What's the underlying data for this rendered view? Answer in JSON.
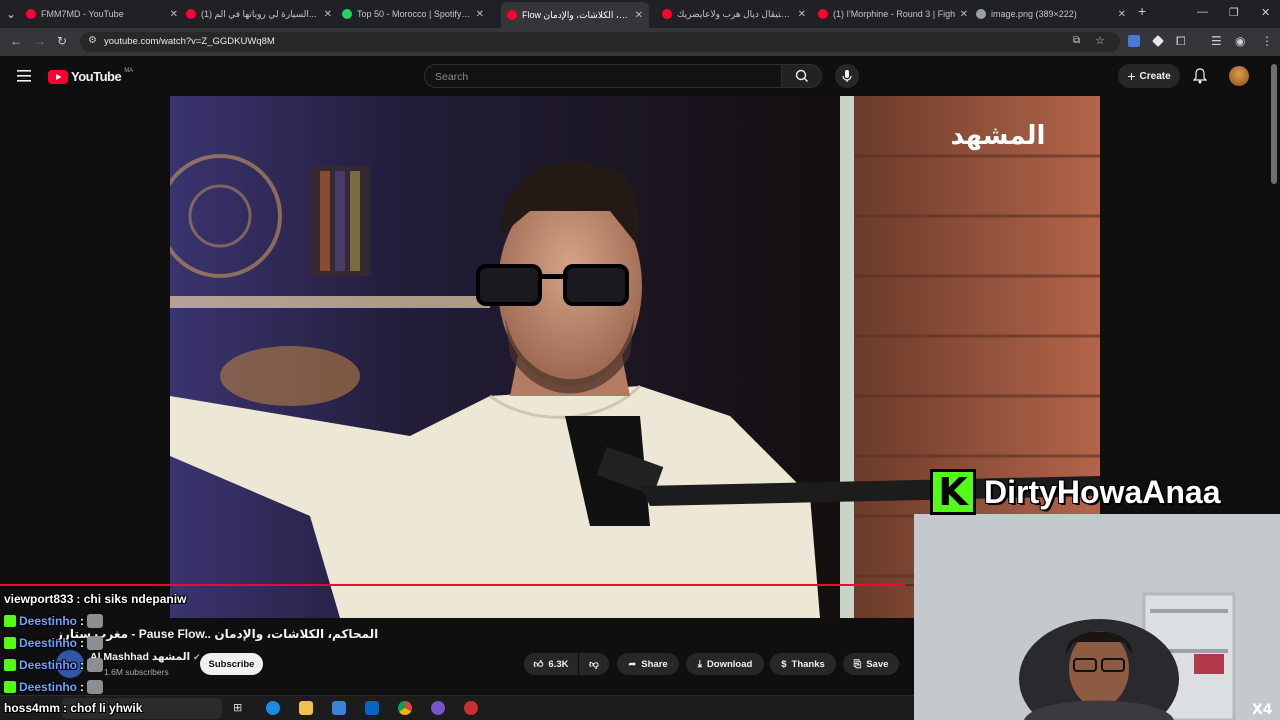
{
  "browser": {
    "tabs": [
      {
        "title": "FMM7MD - YouTube",
        "color": "#ff0033"
      },
      {
        "title": "(1) السيارة لي روباتها في الم...",
        "color": "#ff0033"
      },
      {
        "title": "Top 50 - Morocco | Spotify Play",
        "color": "#1ed760"
      },
      {
        "title": "Flow المحاكم، الكلاشات، والإدمان",
        "color": "#ff0033"
      },
      {
        "title": "فيستيڤال ديال هرب ولاعايضريك",
        "color": "#ff0033"
      },
      {
        "title": "(1) I'Morphine - Round 3 | Figh",
        "color": "#ff0033"
      },
      {
        "title": "image.png (389×222)",
        "color": "#9aa0a6"
      }
    ],
    "url": "youtube.com/watch?v=Z_GGDKUWq8M"
  },
  "youtube": {
    "logo_text": "YouTube",
    "region": "MA",
    "search_placeholder": "Search",
    "create_label": "Create"
  },
  "video": {
    "watermark": "المشهد",
    "title": "مغرب ستارز - Pause Flow.. المحاكم، الكلاشات، والإدمان",
    "channel": "Al Mashhad المشهد",
    "subscribers": "1.6M subscribers",
    "subscribe_label": "Subscribe",
    "likes": "6.3K",
    "share_label": "Share",
    "download_label": "Download",
    "thanks_label": "Thanks",
    "save_label": "Save",
    "progress_fraction": 0.99
  },
  "stream": {
    "streamer_name": "DirtyHowaAnaa",
    "platform_glyph": "K",
    "camera_label": "X4"
  },
  "chat": [
    {
      "user": "viewport833",
      "message": ": chi siks ndepaniw",
      "badge": false,
      "emote": false
    },
    {
      "user": "Deestinho",
      "message": ":",
      "badge": true,
      "emote": true
    },
    {
      "user": "Deestinho",
      "message": ":",
      "badge": true,
      "emote": true
    },
    {
      "user": "Deestinho",
      "message": ":",
      "badge": true,
      "emote": true
    },
    {
      "user": "Deestinho",
      "message": ":",
      "badge": true,
      "emote": true
    },
    {
      "user": "hoss4mm",
      "message": ": chof li yhwik",
      "badge": false,
      "emote": false
    }
  ],
  "colors": {
    "youtube_red": "#ff0033",
    "kick_green": "#53fc18",
    "background": "#0f0f0f"
  }
}
